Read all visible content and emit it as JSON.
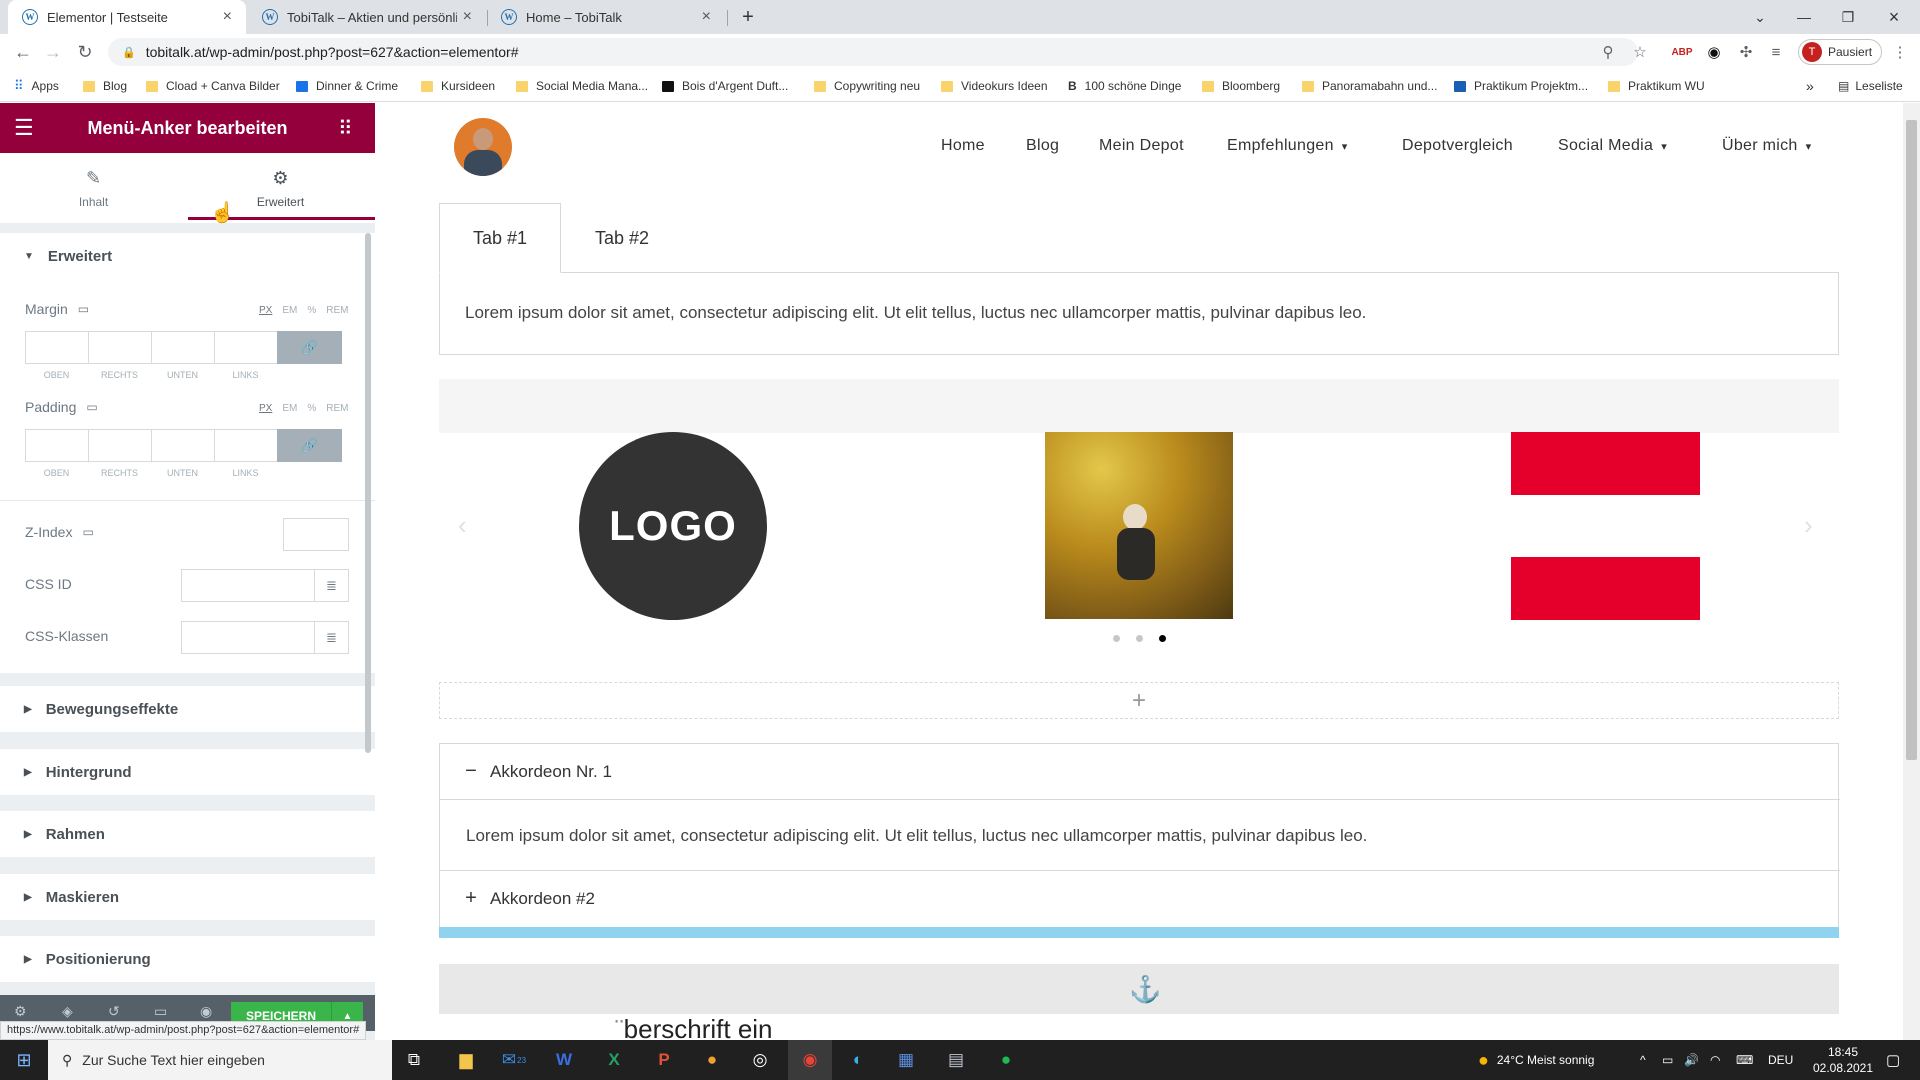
{
  "browser": {
    "tabs": [
      {
        "title": "Elementor | Testseite",
        "active": true
      },
      {
        "title": "TobiTalk – Aktien und persönliche",
        "active": false
      },
      {
        "title": "Home – TobiTalk",
        "active": false
      }
    ],
    "new_tab_symbol": "+",
    "url": "tobitalk.at/wp-admin/post.php?post=627&action=elementor#",
    "profile_initial": "T",
    "profile_label": "Pausiert",
    "bookmarks": [
      "Apps",
      "Blog",
      "Cload + Canva Bilder",
      "Dinner & Crime",
      "Kursideen",
      "Social Media Mana...",
      "Bois d'Argent Duft...",
      "Copywriting neu",
      "Videokurs Ideen",
      "100 schöne Dinge",
      "Bloomberg",
      "Panoramabahn und...",
      "Praktikum Projektm...",
      "Praktikum WU"
    ],
    "more_bookmarks": "»",
    "reading_list": "Leseliste",
    "status_url": "https://www.tobitalk.at/wp-admin/post.php?post=627&action=elementor#"
  },
  "panel": {
    "title": "Menü-Anker bearbeiten",
    "tabs": {
      "content": "Inhalt",
      "advanced": "Erweitert"
    },
    "section_open": "Erweitert",
    "margin_label": "Margin",
    "padding_label": "Padding",
    "units": [
      "PX",
      "EM",
      "%",
      "REM"
    ],
    "dim_labels": [
      "OBEN",
      "RECHTS",
      "UNTEN",
      "LINKS"
    ],
    "zindex_label": "Z-Index",
    "cssid_label": "CSS ID",
    "cssclass_label": "CSS-Klassen",
    "collapsed_sections": [
      "Bewegungseffekte",
      "Hintergrund",
      "Rahmen",
      "Maskieren",
      "Positionierung"
    ],
    "save_label": "SPEICHERN"
  },
  "site": {
    "nav": [
      "Home",
      "Blog",
      "Mein Depot",
      "Empfehlungen",
      "Depotvergleich",
      "Social Media",
      "Über mich"
    ],
    "tabs": [
      "Tab #1",
      "Tab #2"
    ],
    "tab_content": "Lorem ipsum dolor sit amet, consectetur adipiscing elit. Ut elit tellus, luctus nec ullamcorper mattis, pulvinar dapibus leo.",
    "logo_text": "LOGO",
    "carousel_active_dot": 3,
    "add_symbol": "+",
    "accordion": [
      {
        "title": "Akkordeon Nr. 1",
        "open": true,
        "symbol": "−"
      },
      {
        "title": "Akkordeon #2",
        "open": false,
        "symbol": "+"
      }
    ],
    "accordion_content": "Lorem ipsum dolor sit amet, consectetur adipiscing elit. Ut elit tellus, luctus nec ullamcorper mattis, pulvinar dapibus leo.",
    "heading_partial": "berschrift ein"
  },
  "taskbar": {
    "search_placeholder": "Zur Suche Text hier eingeben",
    "mail_badge": "23",
    "weather": "24°C  Meist sonnig",
    "language": "DEU",
    "time": "18:45",
    "date": "02.08.2021"
  }
}
